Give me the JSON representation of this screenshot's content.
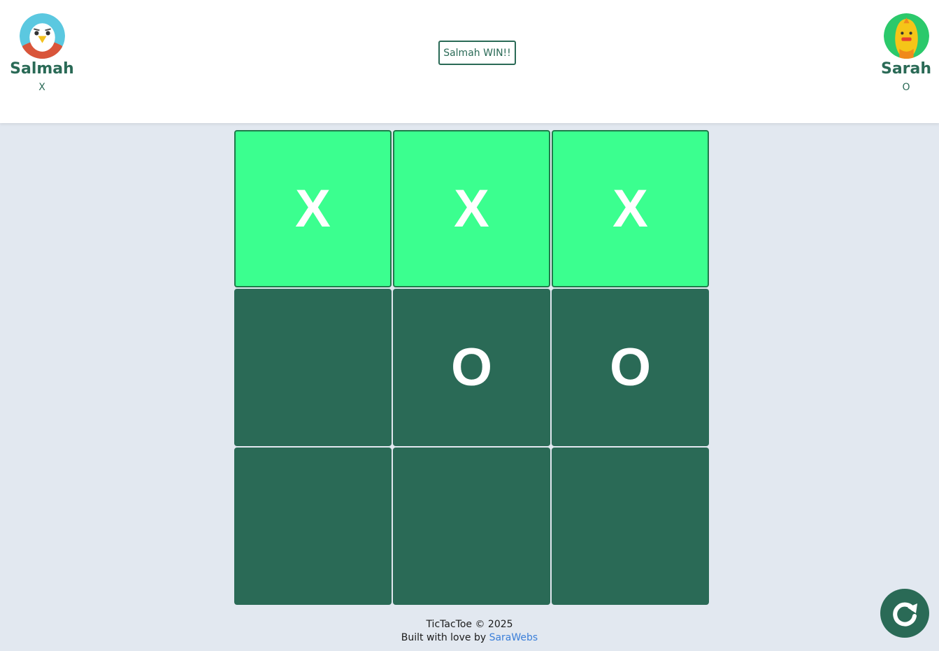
{
  "players": {
    "left": {
      "name": "Salmah",
      "mark": "X",
      "avatar": "eagle-avatar-icon"
    },
    "right": {
      "name": "Sarah",
      "mark": "O",
      "avatar": "chick-avatar-icon"
    }
  },
  "status": "Salmah WIN!!",
  "board": {
    "cells": [
      "X",
      "X",
      "X",
      "",
      "O",
      "O",
      "",
      "",
      ""
    ],
    "winning_cells": [
      0,
      1,
      2
    ]
  },
  "colors": {
    "cell": "#2a6a56",
    "win_cell": "#3bff8f",
    "background": "#e2e8f0",
    "accent": "#2a6a56"
  },
  "footer": {
    "line1": "TicTacToe © 2025",
    "built_prefix": "Built with love by ",
    "link_text": "SaraWebs"
  },
  "restart": {
    "icon": "restart-icon"
  }
}
